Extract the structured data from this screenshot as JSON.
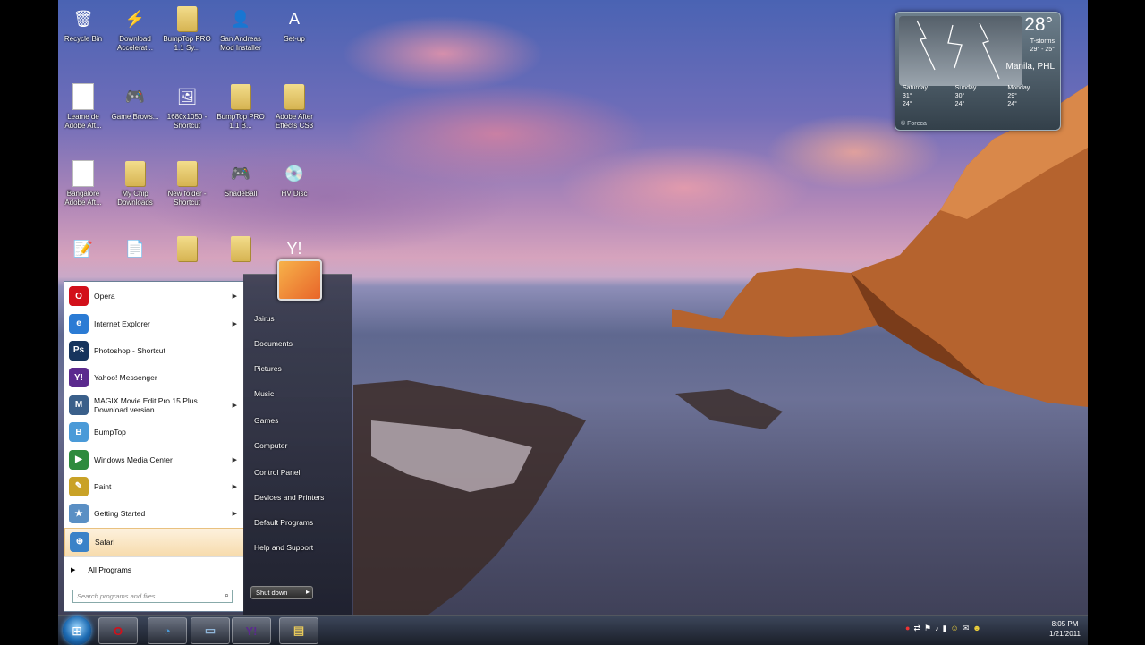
{
  "desktop": {
    "icons": [
      {
        "label": "Recycle Bin",
        "icon": "recycle-bin-icon",
        "glyph": "🗑"
      },
      {
        "label": "Download Accelerat...",
        "icon": "download-accelerator-icon",
        "glyph": "⚡"
      },
      {
        "label": "BumpTop PRO 1.1 Sy...",
        "icon": "folder-icon",
        "glyph": ""
      },
      {
        "label": "San Andreas Mod Installer",
        "icon": "user-photo-icon",
        "glyph": "👤"
      },
      {
        "label": "Set-up",
        "icon": "adobe-icon",
        "glyph": "A"
      },
      {
        "label": "Leame de Adobe Aft...",
        "icon": "document-icon",
        "glyph": ""
      },
      {
        "label": "Game Brows...",
        "icon": "game-icon",
        "glyph": "🎮"
      },
      {
        "label": "1680x1050 - Shortcut",
        "icon": "image-icon",
        "glyph": "🖼"
      },
      {
        "label": "BumpTop PRO 1.1 B...",
        "icon": "folder-icon",
        "glyph": ""
      },
      {
        "label": "Adobe After Effects CS3",
        "icon": "folder-icon",
        "glyph": ""
      },
      {
        "label": "Bangalore Adobe Aft...",
        "icon": "document-icon",
        "glyph": ""
      },
      {
        "label": "My Chip Downloads",
        "icon": "download-folder-icon",
        "glyph": ""
      },
      {
        "label": "New folder - Shortcut",
        "icon": "folder-icon",
        "glyph": ""
      },
      {
        "label": "ShadeBall",
        "icon": "game-icon",
        "glyph": "🎮"
      },
      {
        "label": "HV Disc",
        "icon": "disc-icon",
        "glyph": "💿"
      },
      {
        "label": "",
        "icon": "notes-icon",
        "glyph": "📝"
      },
      {
        "label": "",
        "icon": "setup-icon",
        "glyph": "📄"
      },
      {
        "label": "",
        "icon": "folder-icon",
        "glyph": ""
      },
      {
        "label": "",
        "icon": "folder-icon",
        "glyph": ""
      },
      {
        "label": "",
        "icon": "yahoo-icon",
        "glyph": "Y!"
      }
    ]
  },
  "weather": {
    "temp": "28°",
    "condition": "T-storms",
    "range": "29° - 25°",
    "city": "Manila, PHL",
    "days": [
      {
        "name": "Saturday",
        "high": "31°",
        "low": "24°"
      },
      {
        "name": "Sunday",
        "high": "30°",
        "low": "24°"
      },
      {
        "name": "Monday",
        "high": "29°",
        "low": "24°"
      }
    ],
    "credit": "© Foreca"
  },
  "start_menu": {
    "programs": [
      {
        "label": "Opera",
        "icon": "opera-icon",
        "color": "#d2101a",
        "glyph": "O",
        "arrow": true
      },
      {
        "label": "Internet Explorer",
        "icon": "internet-explorer-icon",
        "color": "#2b7bd4",
        "glyph": "e",
        "arrow": true
      },
      {
        "label": "Photoshop - Shortcut",
        "icon": "photoshop-icon",
        "color": "#16345d",
        "glyph": "Ps",
        "arrow": false
      },
      {
        "label": "Yahoo! Messenger",
        "icon": "yahoo-messenger-icon",
        "color": "#5b2a8e",
        "glyph": "Y!",
        "arrow": false
      },
      {
        "label": "MAGIX Movie Edit Pro 15 Plus Download version",
        "icon": "magix-icon",
        "color": "#3a5f8a",
        "glyph": "M",
        "arrow": true
      },
      {
        "label": "BumpTop",
        "icon": "bumptop-icon",
        "color": "#4a9ad8",
        "glyph": "B",
        "arrow": false
      },
      {
        "label": "Windows Media Center",
        "icon": "media-center-icon",
        "color": "#2e8b3d",
        "glyph": "▶",
        "arrow": true
      },
      {
        "label": "Paint",
        "icon": "paint-icon",
        "color": "#c9a227",
        "glyph": "✎",
        "arrow": true
      },
      {
        "label": "Getting Started",
        "icon": "getting-started-icon",
        "color": "#5a8fc4",
        "glyph": "★",
        "arrow": true
      },
      {
        "label": "Safari",
        "icon": "safari-icon",
        "color": "#3a82c8",
        "glyph": "⊕",
        "arrow": false
      }
    ],
    "all_programs": "All Programs",
    "search_placeholder": "Search programs and files",
    "places": [
      "Jairus",
      "Documents",
      "Pictures",
      "Music",
      "Games",
      "Computer",
      "Control Panel",
      "Devices and Printers",
      "Default Programs",
      "Help and Support"
    ],
    "shutdown": "Shut down"
  },
  "taskbar": {
    "buttons": [
      {
        "icon": "opera-taskbar-icon",
        "glyph": "O",
        "color": "#d2101a"
      },
      {
        "icon": "bumptop-taskbar-icon",
        "glyph": "◔",
        "color": "#4a9ad8"
      },
      {
        "icon": "window-taskbar-icon",
        "glyph": "▭",
        "color": "#8fb5d8"
      },
      {
        "icon": "yahoo-taskbar-icon",
        "glyph": "Y!",
        "color": "#5b2a8e"
      },
      {
        "icon": "explorer-taskbar-icon",
        "glyph": "▤",
        "color": "#e8c95a"
      }
    ],
    "time": "8:05 PM",
    "date": "1/21/2011"
  }
}
